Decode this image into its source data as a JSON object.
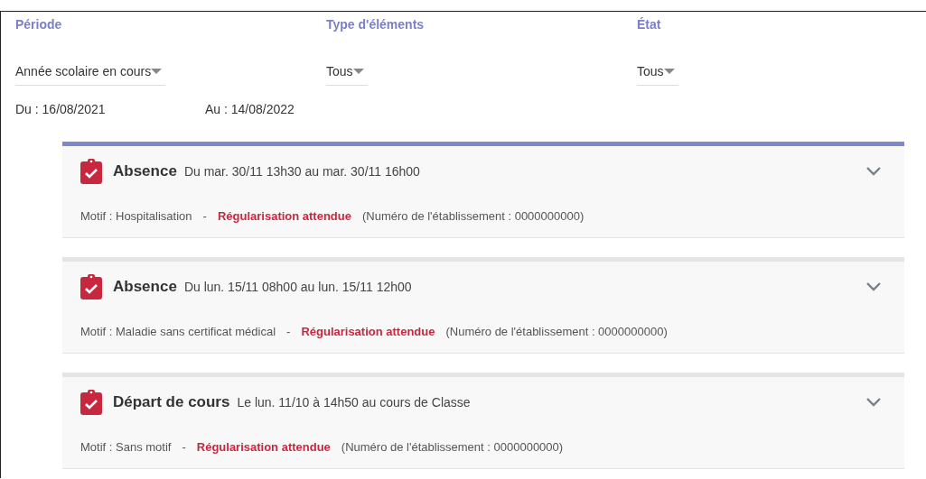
{
  "filters": [
    {
      "label": "Période",
      "value": "Année scolaire en cours"
    },
    {
      "label": "Type d'éléments",
      "value": "Tous"
    },
    {
      "label": "État",
      "value": "Tous"
    }
  ],
  "dates": {
    "from": "Du : 16/08/2021",
    "to": "Au : 14/08/2022"
  },
  "events": [
    {
      "title": "Absence",
      "when": "Du mar. 30/11 13h30 au mar. 30/11 16h00",
      "motif": "Motif : Hospitalisation",
      "separator": "-",
      "status": "Régularisation attendue",
      "detail": "(Numéro de l'établissement : 0000000000)",
      "selected": true,
      "expanded": false
    },
    {
      "title": "Absence",
      "when": "Du lun. 15/11 08h00 au lun. 15/11 12h00",
      "motif": "Motif : Maladie sans certificat médical",
      "separator": "-",
      "status": "Régularisation attendue",
      "detail": "(Numéro de l'établissement : 0000000000)",
      "selected": false,
      "expanded": false
    },
    {
      "title": "Départ de cours",
      "when": "Le lun. 11/10 à 14h50 au cours de Classe",
      "motif": "Motif : Sans motif",
      "separator": "-",
      "status": "Régularisation attendue",
      "detail": "(Numéro de l'établissement : 0000000000)",
      "selected": false,
      "expanded": false
    }
  ]
}
